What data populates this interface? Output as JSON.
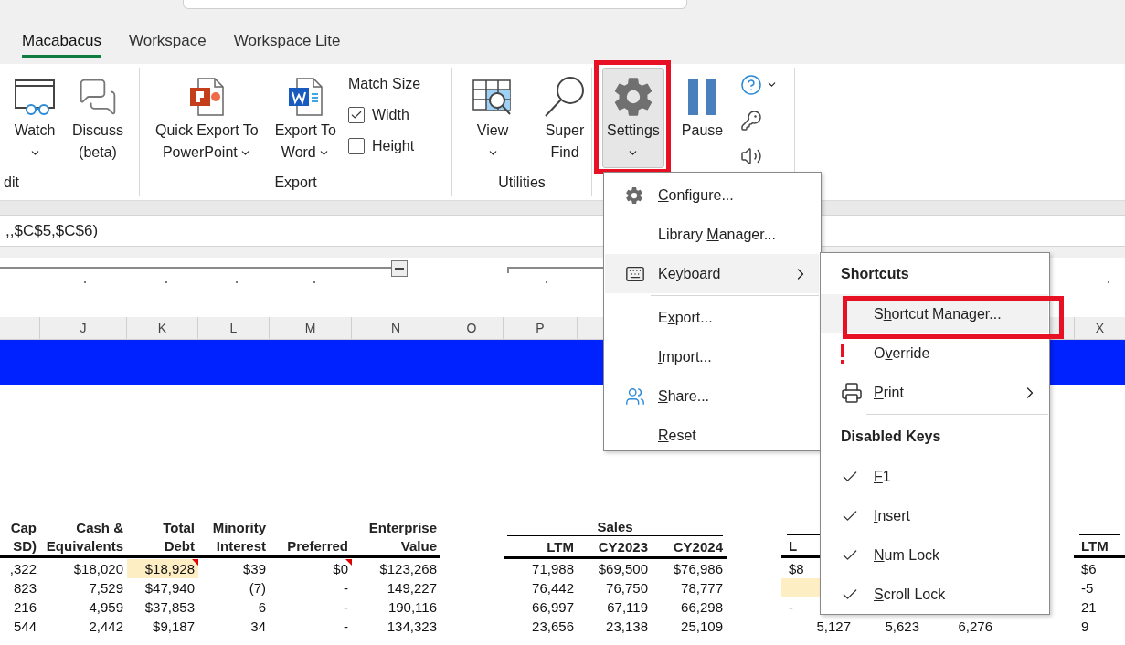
{
  "tabs": [
    {
      "label": "Macabacus",
      "selected": true
    },
    {
      "label": "Workspace",
      "selected": false
    },
    {
      "label": "Workspace Lite",
      "selected": false
    }
  ],
  "ribbon": {
    "groups": [
      {
        "label": "dit",
        "items": [
          {
            "kind": "large",
            "lines": [
              "Watch"
            ],
            "dropdown": true
          },
          {
            "kind": "large",
            "lines": [
              "Discuss",
              "(beta)"
            ],
            "dropdown": false
          }
        ]
      },
      {
        "label": "Export",
        "items": [
          {
            "kind": "large",
            "lines": [
              "Quick Export To",
              "PowerPoint"
            ],
            "dropdown": true
          },
          {
            "kind": "large",
            "lines": [
              "Export To",
              "Word"
            ],
            "dropdown": true
          },
          {
            "kind": "checks",
            "title": "Match Size",
            "options": [
              {
                "label": "Width",
                "checked": true
              },
              {
                "label": "Height",
                "checked": false
              }
            ]
          }
        ]
      },
      {
        "label": "Utilities",
        "items": [
          {
            "kind": "large",
            "lines": [
              "View"
            ],
            "dropdown": true
          },
          {
            "kind": "large",
            "lines": [
              "Super",
              "Find"
            ],
            "dropdown": false
          }
        ]
      },
      {
        "items": [
          {
            "kind": "large",
            "lines": [
              "Settings"
            ],
            "dropdown": true,
            "pressed": true,
            "highlighted": true
          },
          {
            "kind": "large",
            "lines": [
              "Pause"
            ],
            "dropdown": false
          },
          {
            "kind": "small_stack",
            "buttons": [
              {
                "dropdown": true
              },
              {
                "dropdown": false
              },
              {
                "dropdown": false
              }
            ]
          }
        ]
      }
    ]
  },
  "formula_bar": {
    "text": ",,$C$5,$C$6)"
  },
  "column_headers": {
    "left": [
      "J",
      "K",
      "L",
      "M",
      "N",
      "O",
      "P"
    ],
    "right": [
      "X"
    ]
  },
  "table": {
    "group_header": "Sales",
    "columns": [
      {
        "header": [
          "Cap",
          "SD)"
        ]
      },
      {
        "header": [
          "Cash &",
          "Equivalents"
        ]
      },
      {
        "header": [
          "Total",
          "Debt"
        ]
      },
      {
        "header": [
          "Minority",
          "Interest"
        ]
      },
      {
        "header": [
          "Preferred"
        ]
      },
      {
        "header": [
          "Enterprise",
          "Value"
        ]
      },
      {},
      {
        "header": [
          "LTM"
        ]
      },
      {
        "header": [
          "CY2023"
        ]
      },
      {
        "header": [
          "CY2024"
        ]
      },
      {},
      {
        "header": [
          "L"
        ]
      },
      {},
      {},
      {},
      {
        "header": [
          "LTM"
        ]
      }
    ],
    "rows": [
      [
        {
          "text": ",322"
        },
        {
          "text": "$18,020"
        },
        {
          "text": "$18,928",
          "highlight": true,
          "comment": true
        },
        {
          "text": "$39"
        },
        {
          "text": "$0",
          "comment": true
        },
        {
          "text": "$123,268"
        },
        {},
        {
          "text": "71,988"
        },
        {
          "text": "$69,500"
        },
        {
          "text": "$76,986"
        },
        {},
        {
          "text": "$8"
        },
        {},
        {},
        {},
        {
          "text": "$6"
        }
      ],
      [
        {
          "text": "823"
        },
        {
          "text": "7,529"
        },
        {
          "text": "$47,940"
        },
        {
          "text": "(7)"
        },
        {
          "text": "-"
        },
        {
          "text": "149,227"
        },
        {},
        {
          "text": "76,442"
        },
        {
          "text": "76,750"
        },
        {
          "text": "78,777"
        },
        {},
        {
          "highlight": true
        },
        {},
        {},
        {},
        {
          "text": "-5"
        }
      ],
      [
        {
          "text": "216"
        },
        {
          "text": "4,959"
        },
        {
          "text": "$37,853"
        },
        {
          "text": "6"
        },
        {
          "text": "-"
        },
        {
          "text": "190,116"
        },
        {},
        {
          "text": "66,997"
        },
        {
          "text": "67,119"
        },
        {
          "text": "66,298"
        },
        {},
        {
          "text": "-"
        },
        {},
        {},
        {},
        {
          "text": "21"
        }
      ],
      [
        {
          "text": "544"
        },
        {
          "text": "2,442"
        },
        {
          "text": "$9,187"
        },
        {
          "text": "34"
        },
        {
          "text": "-"
        },
        {
          "text": "134,323"
        },
        {},
        {
          "text": "23,656"
        },
        {
          "text": "23,138"
        },
        {
          "text": "25,109"
        },
        {},
        {
          "text": "5,127"
        },
        {
          "text": "5,623"
        },
        {
          "text": "6,276"
        },
        {},
        {
          "text": "9"
        }
      ]
    ]
  },
  "settings_menu": [
    {
      "kind": "item",
      "key": "C",
      "after": "onfigure..."
    },
    {
      "kind": "item",
      "before": "Library ",
      "key": "M",
      "after": "anager..."
    },
    {
      "kind": "item",
      "key": "K",
      "after": "eyboard",
      "submenu": true,
      "hovered": true
    },
    {
      "kind": "separator"
    },
    {
      "kind": "item",
      "before": "E",
      "key": "x",
      "after": "port..."
    },
    {
      "kind": "item",
      "key": "I",
      "after": "mport..."
    },
    {
      "kind": "item",
      "key": "S",
      "after": "hare..."
    },
    {
      "kind": "item",
      "key": "R",
      "after": "eset"
    }
  ],
  "keyboard_submenu": [
    {
      "kind": "heading",
      "text": "Shortcuts"
    },
    {
      "kind": "item",
      "before": "S",
      "key": "h",
      "after": "ortcut Manager...",
      "hovered": true,
      "highlighted": true
    },
    {
      "kind": "item",
      "before": "O",
      "key": "v",
      "after": "erride"
    },
    {
      "kind": "item",
      "key": "P",
      "after": "rint",
      "submenu": true
    },
    {
      "kind": "separator"
    },
    {
      "kind": "heading",
      "text": "Disabled Keys"
    },
    {
      "kind": "item",
      "key": "F",
      "after": "1",
      "checked": true
    },
    {
      "kind": "item",
      "key": "I",
      "after": "nsert",
      "checked": true
    },
    {
      "kind": "item",
      "key": "N",
      "after": "um Lock",
      "checked": true
    },
    {
      "kind": "item",
      "key": "S",
      "after": "croll Lock",
      "checked": true
    }
  ]
}
